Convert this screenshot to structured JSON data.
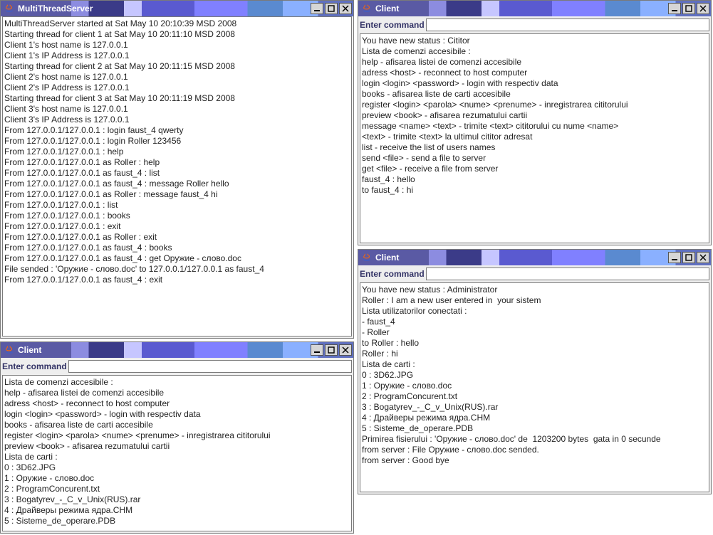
{
  "windows": {
    "server": {
      "title": "MultiThreadServer",
      "lines": [
        "MultiThreadServer started at Sat May 10 20:10:39 MSD 2008",
        "Starting thread for client 1 at Sat May 10 20:11:10 MSD 2008",
        "Client 1's host name is 127.0.0.1",
        "Client 1's IP Address is 127.0.0.1",
        "Starting thread for client 2 at Sat May 10 20:11:15 MSD 2008",
        "Client 2's host name is 127.0.0.1",
        "Client 2's IP Address is 127.0.0.1",
        "Starting thread for client 3 at Sat May 10 20:11:19 MSD 2008",
        "Client 3's host name is 127.0.0.1",
        "Client 3's IP Address is 127.0.0.1",
        "From 127.0.0.1/127.0.0.1 : login faust_4 qwerty",
        "From 127.0.0.1/127.0.0.1 : login Roller 123456",
        "From 127.0.0.1/127.0.0.1 : help",
        "From 127.0.0.1/127.0.0.1 as Roller : help",
        "From 127.0.0.1/127.0.0.1 as faust_4 : list",
        "From 127.0.0.1/127.0.0.1 as faust_4 : message Roller hello",
        "From 127.0.0.1/127.0.0.1 as Roller : message faust_4 hi",
        "From 127.0.0.1/127.0.0.1 : list",
        "From 127.0.0.1/127.0.0.1 : books",
        "From 127.0.0.1/127.0.0.1 : exit",
        "From 127.0.0.1/127.0.0.1 as Roller : exit",
        "From 127.0.0.1/127.0.0.1 as faust_4 : books",
        "From 127.0.0.1/127.0.0.1 as faust_4 : get Оружие - слово.doc",
        "File sended : 'Оружие - слово.doc' to 127.0.0.1/127.0.0.1 as faust_4",
        "From 127.0.0.1/127.0.0.1 as faust_4 : exit"
      ]
    },
    "client_bl": {
      "title": "Client",
      "cmd_label": "Enter command",
      "cmd_value": "",
      "lines": [
        "Lista de comenzi accesibile :",
        "help - afisarea listei de comenzi accesibile",
        "adress <host> - reconnect to host computer",
        "login <login> <password> - login with respectiv data",
        "books - afisarea liste de carti accesibile",
        "register <login> <parola> <nume> <prenume> - inregistrarea cititorului",
        "preview <book> - afisarea rezumatului cartii",
        "Lista de carti :",
        "0 : 3D62.JPG",
        "1 : Оружие - слово.doc",
        "2 : ProgramConcurent.txt",
        "3 : Bogatyrev_-_C_v_Unix(RUS).rar",
        "4 : Драйверы режима ядра.CHM",
        "5 : Sisteme_de_operare.PDB"
      ]
    },
    "client_tr": {
      "title": "Client",
      "cmd_label": "Enter command",
      "cmd_value": "",
      "lines": [
        "You have new status : Cititor",
        "Lista de comenzi accesibile :",
        "help - afisarea listei de comenzi accesibile",
        "adress <host> - reconnect to host computer",
        "login <login> <password> - login with respectiv data",
        "books - afisarea liste de carti accesibile",
        "register <login> <parola> <nume> <prenume> - inregistrarea cititorului",
        "preview <book> - afisarea rezumatului cartii",
        "message <name> <text> - trimite <text> cititorului cu nume <name>",
        "<text> - trimite <text> la ultimul cititor adresat",
        "list - receive the list of users names",
        "send <file> - send a file to server",
        "get <file> - receive a file from server",
        "faust_4 : hello",
        "to faust_4 : hi"
      ]
    },
    "client_br": {
      "title": "Client",
      "cmd_label": "Enter command",
      "cmd_value": "",
      "lines": [
        "You have new status : Administrator",
        "Roller : I am a new user entered in  your sistem",
        "Lista utilizatorilor conectati :",
        "- faust_4",
        "- Roller",
        "to Roller : hello",
        "Roller : hi",
        "Lista de carti :",
        "0 : 3D62.JPG",
        "1 : Оружие - слово.doc",
        "2 : ProgramConcurent.txt",
        "3 : Bogatyrev_-_C_v_Unix(RUS).rar",
        "4 : Драйверы режима ядра.CHM",
        "5 : Sisteme_de_operare.PDB",
        "Primirea fisierului : 'Оружие - слово.doc' de  1203200 bytes  gata in 0 secunde",
        "from server : File Оружие - слово.doc sended.",
        "from server : Good bye"
      ]
    }
  }
}
